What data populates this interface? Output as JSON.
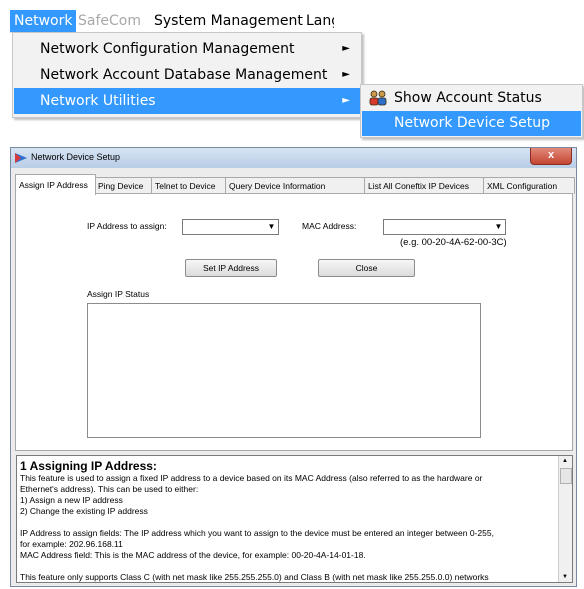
{
  "menubar": {
    "items": [
      "Network",
      "SafeCom",
      "System Management",
      "Lang"
    ]
  },
  "network_menu": {
    "items": [
      {
        "label": "Network Configuration Management"
      },
      {
        "label": "Network Account Database Management"
      },
      {
        "label": "Network Utilities"
      }
    ],
    "submenu_arrow": "►"
  },
  "utilities_submenu": {
    "items": [
      {
        "label": "Show Account Status",
        "icon": "users-icon"
      },
      {
        "label": "Network Device Setup"
      }
    ]
  },
  "dialog": {
    "title": "Network Device Setup",
    "close_glyph": "x",
    "tabs": [
      "Assign IP Address",
      "Ping Device",
      "Telnet to Device",
      "Query Device Information",
      "List All Coneftix IP Devices",
      "XML Configuration"
    ],
    "assign": {
      "ip_label": "IP Address to assign:",
      "ip_value": "",
      "mac_label": "MAC Address:",
      "mac_value": "",
      "mac_example": "(e.g. 00-20-4A-62-00-3C)",
      "set_ip_button": "Set IP Address",
      "close_button": "Close",
      "status_label": "Assign IP Status",
      "status_text": ""
    },
    "help": {
      "heading": "1 Assigning IP Address:",
      "lines": [
        "This feature is used to assign a fixed IP address to a device based on its MAC Address (also referred to as the hardware or",
        "Ethernet's address). This can be used to either:",
        "1) Assign a new IP address",
        "2) Change the existing IP address"
      ],
      "lines2": [
        "IP Address to assign fields: The IP address which you want to assign to the device must be entered an integer between 0-255,",
        "for example: 202.96.168.11",
        "MAC Address field: This is the MAC address of the device, for example: 00-20-4A-14-01-18."
      ],
      "cut_line": "This feature only supports Class C (with net mask like 255.255.255.0) and Class B (with net mask like 255.255.0.0) networks"
    },
    "colors": {
      "menu_highlight": "#3399ff",
      "title_gradient": "#c8d9ee",
      "close_button": "#c24532"
    }
  }
}
